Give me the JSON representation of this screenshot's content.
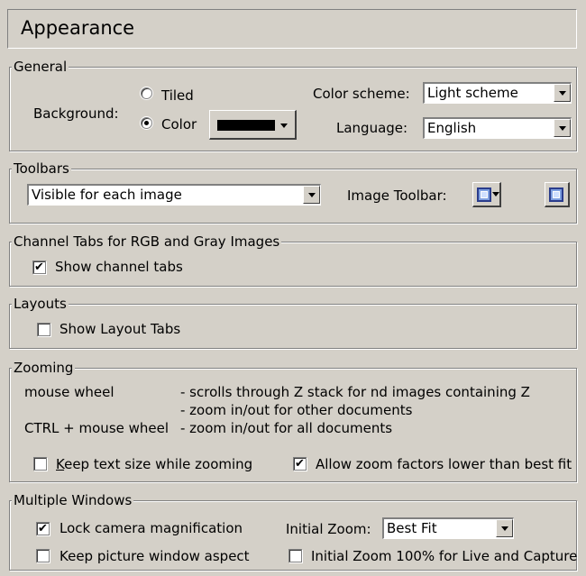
{
  "title": "Appearance",
  "general": {
    "legend": "General",
    "background_label": "Background:",
    "tiled_label": "Tiled",
    "color_label": "Color",
    "background_mode": "color",
    "color_value": "#000000",
    "color_scheme_label": "Color scheme:",
    "color_scheme_value": "Light scheme",
    "language_label": "Language:",
    "language_value": "English"
  },
  "toolbars": {
    "legend": "Toolbars",
    "visibility_value": "Visible for each image",
    "image_toolbar_label": "Image Toolbar:"
  },
  "channel_tabs": {
    "legend": "Channel Tabs for RGB and  Gray Images",
    "show_channel_tabs_label": "Show channel tabs",
    "show_channel_tabs_checked": true
  },
  "layouts": {
    "legend": "Layouts",
    "show_layout_tabs_label": "Show Layout Tabs",
    "show_layout_tabs_checked": false
  },
  "zooming": {
    "legend": "Zooming",
    "mouse_wheel_label": "mouse wheel",
    "mouse_wheel_desc_1": "-  scrolls through Z stack for nd images containing Z",
    "mouse_wheel_desc_2": "-  zoom in/out for other documents",
    "ctrl_wheel_label": "CTRL + mouse wheel",
    "ctrl_wheel_desc": "-  zoom in/out for all documents",
    "keep_text_size_first": "K",
    "keep_text_size_rest": "eep text size while zooming",
    "keep_text_size_checked": false,
    "allow_zoom_lower_label": "Allow zoom factors lower than best fit",
    "allow_zoom_lower_checked": true
  },
  "multiple_windows": {
    "legend": "Multiple Windows",
    "lock_camera_label": "Lock camera magnification",
    "lock_camera_checked": true,
    "initial_zoom_label": "Initial Zoom:",
    "initial_zoom_value": "Best Fit",
    "keep_aspect_label": "Keep picture window aspect",
    "keep_aspect_checked": false,
    "initial_zoom_100_label": "Initial Zoom 100% for Live and Capture",
    "initial_zoom_100_checked": false
  }
}
